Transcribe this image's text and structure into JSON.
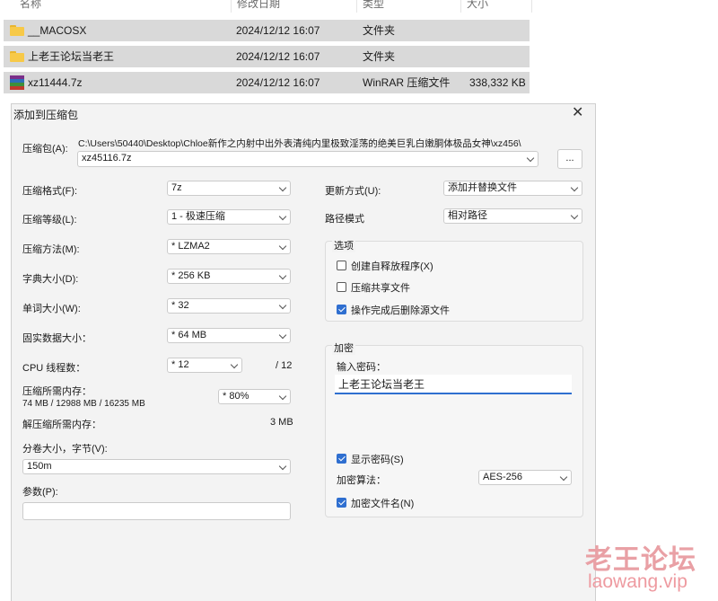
{
  "explorer": {
    "columns": {
      "name": "名称",
      "modified": "修改日期",
      "type": "类型",
      "size": "大小"
    },
    "files": [
      {
        "name": "__MACOSX",
        "modified": "2024/12/12 16:07",
        "type": "文件夹",
        "size": "",
        "icon": "folder-icon"
      },
      {
        "name": "上老王论坛当老王",
        "modified": "2024/12/12 16:07",
        "type": "文件夹",
        "size": "",
        "icon": "folder-icon"
      },
      {
        "name": "xz11444.7z",
        "modified": "2024/12/12 16:07",
        "type": "WinRAR 压缩文件",
        "size": "338,332 KB",
        "icon": "winrar-archive-icon"
      }
    ]
  },
  "dialog": {
    "title": "添加到压缩包",
    "archive": {
      "label": "压缩包(A):",
      "path": "C:\\Users\\50440\\Desktop\\Chloe新作之内射中出外表清纯内里极致淫荡的绝美巨乳白嫩胴体极品女神\\xz456\\",
      "filename": "xz45116.7z",
      "browse_label": "..."
    },
    "left": {
      "format": {
        "label": "压缩格式(F):",
        "value": "7z"
      },
      "level": {
        "label": "压缩等级(L):",
        "value": "1 - 极速压缩"
      },
      "method": {
        "label": "压缩方法(M):",
        "value": "* LZMA2"
      },
      "dict": {
        "label": "字典大小(D):",
        "value": "* 256 KB"
      },
      "word": {
        "label": "单词大小(W):",
        "value": "* 32"
      },
      "solid": {
        "label": "固实数据大小：",
        "value": "* 64 MB"
      },
      "threads": {
        "label": "CPU 线程数：",
        "value": "* 12",
        "max": "/ 12"
      },
      "mem_compress": {
        "label": "压缩所需内存：",
        "detail": "74 MB / 12988 MB / 16235 MB",
        "value": "* 80%"
      },
      "mem_decompress": {
        "label": "解压缩所需内存：",
        "value": "3 MB"
      },
      "volume": {
        "label": "分卷大小，字节(V):",
        "value": "150m"
      },
      "params": {
        "label": "参数(P):",
        "value": ""
      }
    },
    "right": {
      "update_mode": {
        "label": "更新方式(U):",
        "value": "添加并替换文件"
      },
      "path_mode": {
        "label": "路径模式",
        "value": "相对路径"
      },
      "options": {
        "title": "选项",
        "items": [
          {
            "label": "创建自释放程序(X)",
            "checked": false
          },
          {
            "label": "压缩共享文件",
            "checked": false
          },
          {
            "label": "操作完成后删除源文件",
            "checked": true
          }
        ]
      },
      "encryption": {
        "title": "加密",
        "password_label": "输入密码：",
        "password": "上老王论坛当老王",
        "show_password": {
          "label": "显示密码(S)",
          "checked": true
        },
        "method_label": "加密算法：",
        "method": "AES-256",
        "encrypt_names": {
          "label": "加密文件名(N)",
          "checked": true
        }
      }
    }
  },
  "watermark": {
    "line1": "老王论坛",
    "line2": "laowang.vip"
  },
  "colors": {
    "accent": "#2f6fd0",
    "row_selected": "#d9d9d9",
    "folder": "#f7c948",
    "watermark": "#e9a0a5"
  }
}
